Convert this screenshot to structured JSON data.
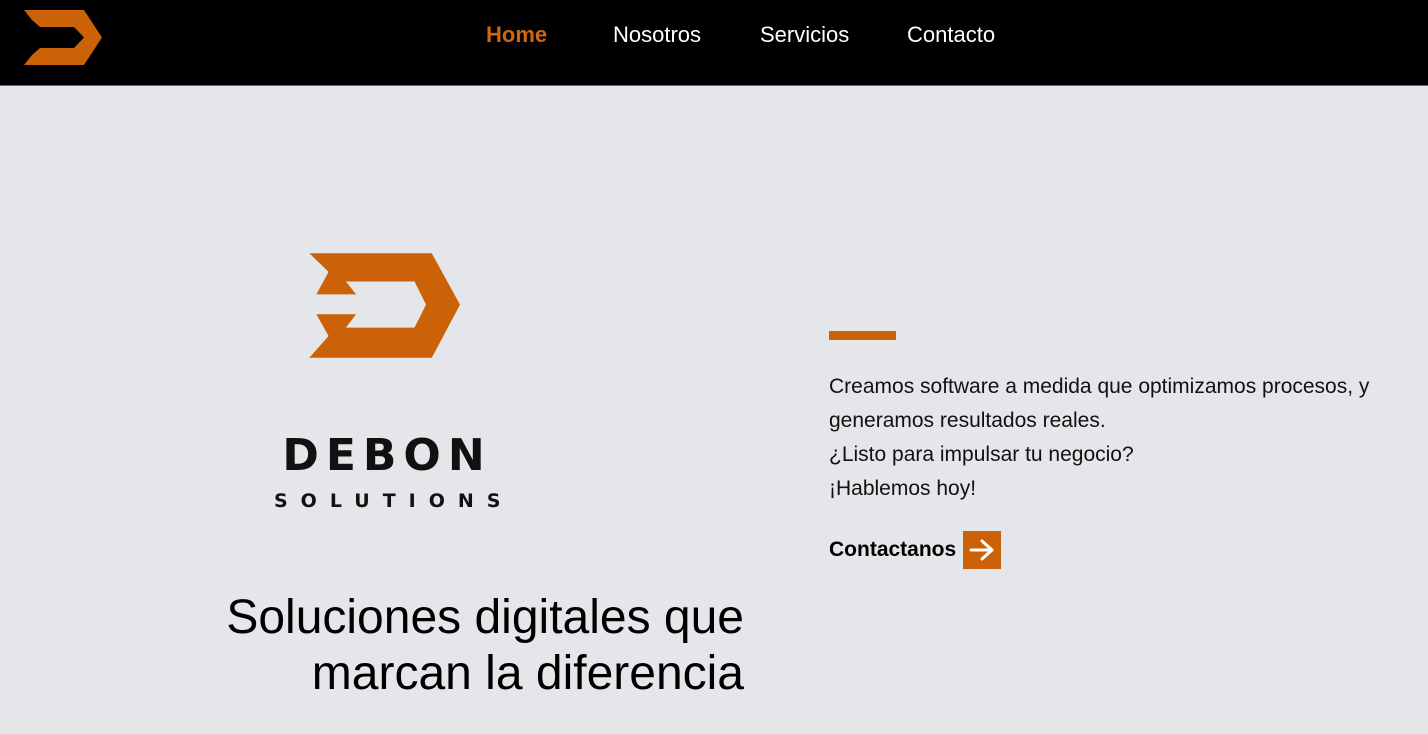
{
  "nav": {
    "logo_icon": "debon-d-logo-icon",
    "links": [
      {
        "label": "Home",
        "active": true
      },
      {
        "label": "Nosotros",
        "active": false
      },
      {
        "label": "Servicios",
        "active": false
      },
      {
        "label": "Contacto",
        "active": false
      }
    ]
  },
  "brand": {
    "name": "DEBON",
    "subtitle": "SOLUTIONS"
  },
  "hero": {
    "headline_line1": "Soluciones digitales que",
    "headline_line2": "marcan la diferencia",
    "intro_lines": [
      "Creamos software a medida que optimizamos procesos, y",
      "generamos resultados reales.",
      "¿Listo para impulsar tu negocio?",
      "¡Hablemos hoy!"
    ],
    "cta_label": "Contactanos",
    "cta_icon": "arrow-right-icon"
  },
  "colors": {
    "accent": "#cb6207",
    "nav_background": "#000000",
    "page_background": "#e5e6e9"
  }
}
